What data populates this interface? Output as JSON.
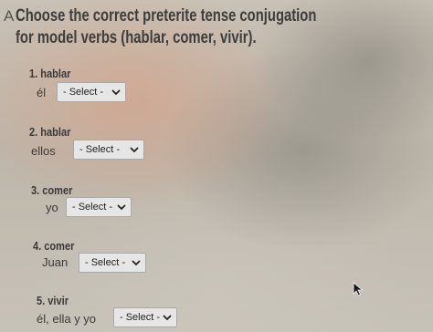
{
  "prompt": {
    "marker": "A",
    "text": "Choose the correct preterite tense conjugation for model verbs (hablar, comer, vivir)."
  },
  "questions": [
    {
      "number": "1. hablar",
      "subject": "él",
      "selected": "- Select -"
    },
    {
      "number": "2. hablar",
      "subject": "ellos",
      "selected": "- Select -"
    },
    {
      "number": "3. comer",
      "subject": "yo",
      "selected": "- Select -"
    },
    {
      "number": "4. comer",
      "subject": "Juan",
      "selected": "- Select -"
    },
    {
      "number": "5. vivir",
      "subject": "él, ella y yo",
      "selected": "- Select -"
    }
  ],
  "icons": {
    "dropdown": "chevron-down-icon",
    "cursor": "mouse-pointer-icon"
  },
  "colors": {
    "select_background": "#e6e6e6",
    "select_border": "#a9a9a9",
    "text": "#303030"
  }
}
